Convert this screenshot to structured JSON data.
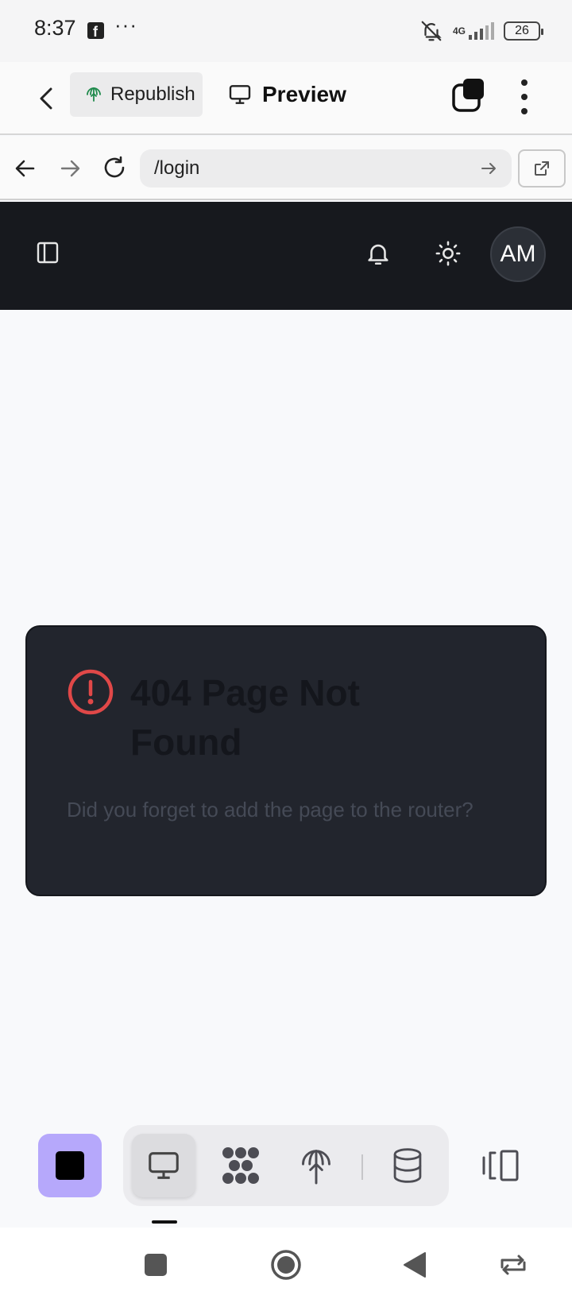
{
  "status_bar": {
    "time": "8:37",
    "more": "···",
    "network": "4G",
    "battery": "26",
    "icons": [
      "facebook-icon",
      "bell-off-icon",
      "signal-icon",
      "battery-icon"
    ]
  },
  "header": {
    "republish_label": "Republish",
    "preview_label": "Preview",
    "icons": [
      "back-arrow-icon",
      "globe-upload-icon",
      "monitor-icon",
      "tabs-icon",
      "kebab-menu-icon"
    ]
  },
  "browser": {
    "url": "/login",
    "icons": [
      "back-icon",
      "forward-icon",
      "reload-icon",
      "go-arrow-icon",
      "open-external-icon"
    ]
  },
  "app_nav": {
    "avatar_initials": "AM",
    "icons": [
      "sidebar-toggle-icon",
      "bell-icon",
      "sun-icon"
    ]
  },
  "error_card": {
    "title": "404 Page Not Found",
    "description": "Did you forget to add the page to the router?",
    "colors": {
      "icon": "#e04848",
      "card": "#22252d"
    }
  },
  "toolbar": {
    "accent": "#b6a8fb",
    "tools": [
      "monitor-icon",
      "workflow-icon",
      "publish-icon",
      "database-icon"
    ],
    "icons": [
      "stop-icon",
      "panel-toggle-icon"
    ]
  },
  "android_nav": {
    "icons": [
      "recents-icon",
      "home-icon",
      "back-icon",
      "rotate-icon"
    ]
  }
}
